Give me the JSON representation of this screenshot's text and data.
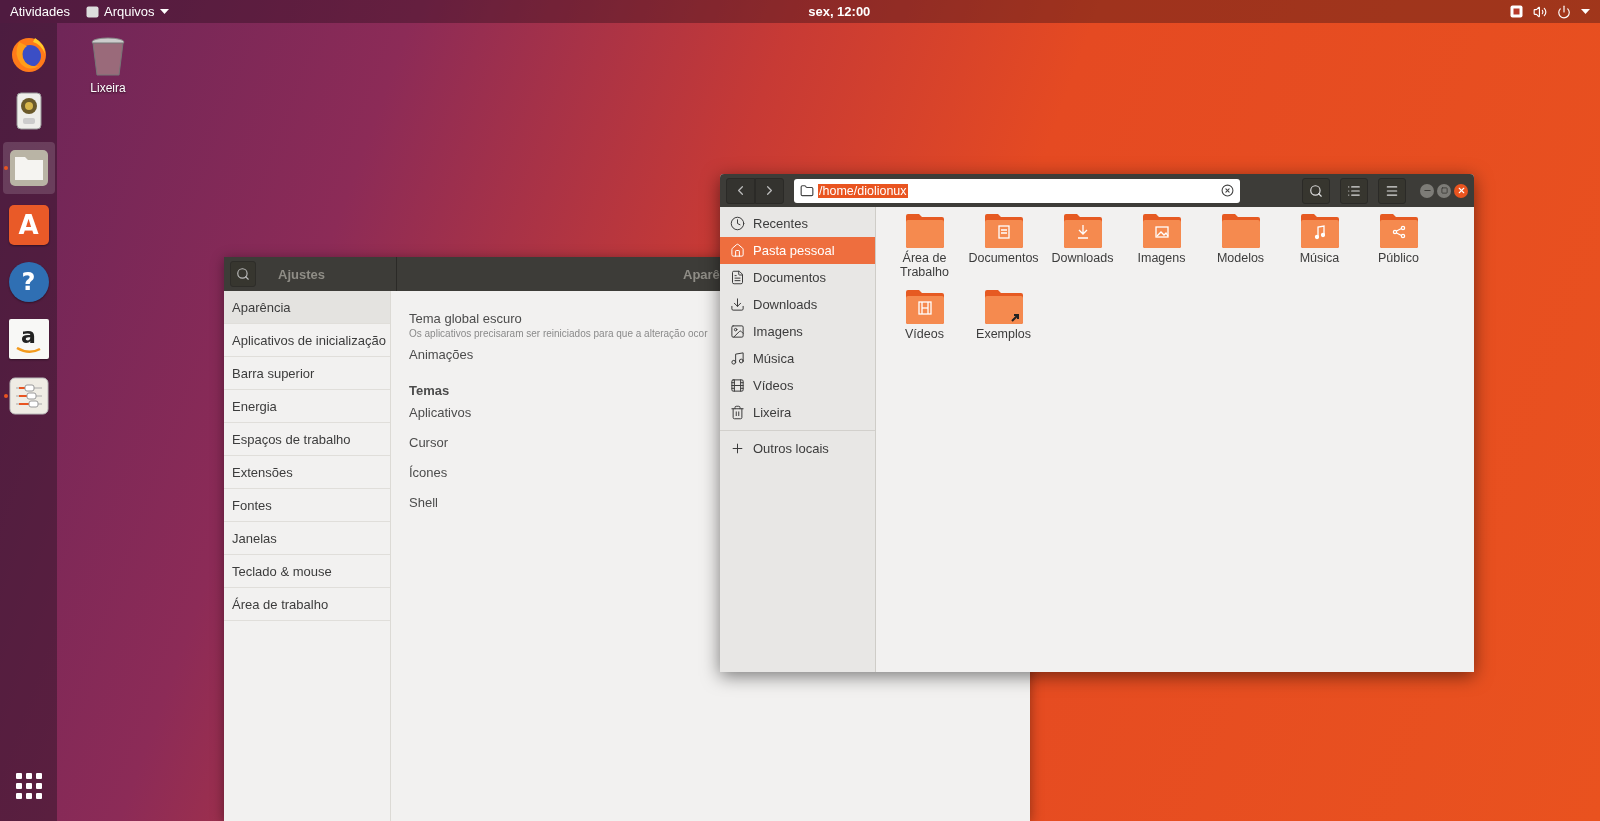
{
  "top_bar": {
    "activities": "Atividades",
    "app_menu": "Arquivos",
    "clock": "sex, 12:00"
  },
  "dock": {
    "items": [
      {
        "kind": "firefox",
        "selected": false,
        "running": false
      },
      {
        "kind": "speaker",
        "selected": false,
        "running": false
      },
      {
        "kind": "files",
        "selected": true,
        "running": true
      },
      {
        "kind": "software",
        "glyph": "A",
        "selected": false,
        "running": false
      },
      {
        "kind": "help",
        "glyph": "?",
        "selected": false,
        "running": false
      },
      {
        "kind": "amazon",
        "glyph": "a",
        "selected": false,
        "running": false
      },
      {
        "kind": "tweaks",
        "selected": false,
        "running": true
      }
    ]
  },
  "desktop_icons": [
    {
      "label": "Lixeira"
    }
  ],
  "tweaks_window": {
    "title": "Ajustes",
    "page_title": "Aparê",
    "sidebar": [
      {
        "label": "Aparência",
        "selected": true
      },
      {
        "label": "Aplicativos de inicialização",
        "selected": false
      },
      {
        "label": "Barra superior",
        "selected": false
      },
      {
        "label": "Energia",
        "selected": false
      },
      {
        "label": "Espaços de trabalho",
        "selected": false
      },
      {
        "label": "Extensões",
        "selected": false
      },
      {
        "label": "Fontes",
        "selected": false
      },
      {
        "label": "Janelas",
        "selected": false
      },
      {
        "label": "Teclado & mouse",
        "selected": false
      },
      {
        "label": "Área de trabalho",
        "selected": false
      }
    ],
    "settings": [
      {
        "kind": "described",
        "label": "Tema global escuro",
        "description": "Os aplicativos precisaram ser reiniciados para que a alteração ocor"
      },
      {
        "kind": "row",
        "label": "Animações"
      },
      {
        "kind": "heading",
        "label": "Temas"
      },
      {
        "kind": "row",
        "label": "Aplicativos"
      },
      {
        "kind": "row",
        "label": "Cursor"
      },
      {
        "kind": "row",
        "label": "Ícones"
      },
      {
        "kind": "row",
        "label": "Shell"
      }
    ]
  },
  "files_window": {
    "path": "/home/diolionux",
    "sidebar": [
      {
        "kind": "recent",
        "label": "Recentes",
        "selected": false
      },
      {
        "kind": "home",
        "label": "Pasta pessoal",
        "selected": true
      },
      {
        "kind": "documents",
        "label": "Documentos",
        "selected": false
      },
      {
        "kind": "downloads",
        "label": "Downloads",
        "selected": false
      },
      {
        "kind": "images",
        "label": "Imagens",
        "selected": false
      },
      {
        "kind": "music",
        "label": "Música",
        "selected": false
      },
      {
        "kind": "videos",
        "label": "Vídeos",
        "selected": false
      },
      {
        "kind": "trash",
        "label": "Lixeira",
        "selected": false
      },
      {
        "kind": "other",
        "label": "Outros locais",
        "selected": false
      }
    ],
    "folders": [
      {
        "kind": "plain",
        "label": "Área de Trabalho"
      },
      {
        "kind": "documents",
        "label": "Documentos"
      },
      {
        "kind": "downloads",
        "label": "Downloads"
      },
      {
        "kind": "images",
        "label": "Imagens"
      },
      {
        "kind": "plain",
        "label": "Modelos"
      },
      {
        "kind": "music",
        "label": "Música"
      },
      {
        "kind": "share",
        "label": "Público"
      },
      {
        "kind": "videos",
        "label": "Vídeos"
      },
      {
        "kind": "link",
        "label": "Exemplos"
      }
    ]
  }
}
